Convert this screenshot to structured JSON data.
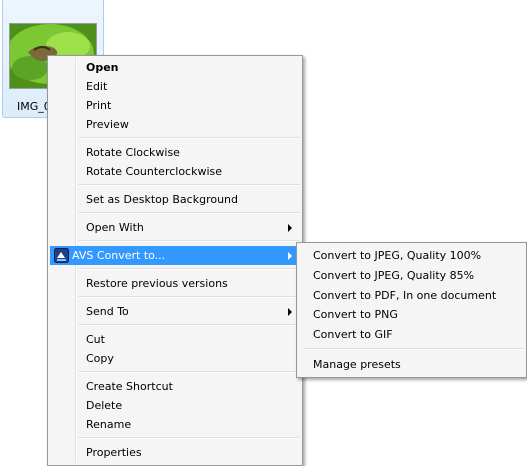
{
  "file": {
    "name": "IMG_0"
  },
  "context_menu": {
    "open": "Open",
    "edit": "Edit",
    "print": "Print",
    "preview": "Preview",
    "rotate_cw": "Rotate Clockwise",
    "rotate_ccw": "Rotate Counterclockwise",
    "desktop_bg": "Set as Desktop Background",
    "open_with": "Open With",
    "avs_convert": "AVS Convert to...",
    "restore_versions": "Restore previous versions",
    "send_to": "Send To",
    "cut": "Cut",
    "copy": "Copy",
    "create_shortcut": "Create Shortcut",
    "delete": "Delete",
    "rename": "Rename",
    "properties": "Properties"
  },
  "submenu": {
    "items": [
      "Convert to JPEG, Quality 100%",
      "Convert to JPEG, Quality 85%",
      "Convert to PDF, In one document",
      "Convert to PNG",
      "Convert to GIF"
    ],
    "manage_presets": "Manage presets"
  },
  "colors": {
    "highlight": "#3399ff",
    "menu_bg": "#f5f5f5",
    "border": "#979797"
  },
  "icons": {
    "avs": "avs-convert-icon",
    "submenu_arrow": "chevron-right-icon"
  }
}
